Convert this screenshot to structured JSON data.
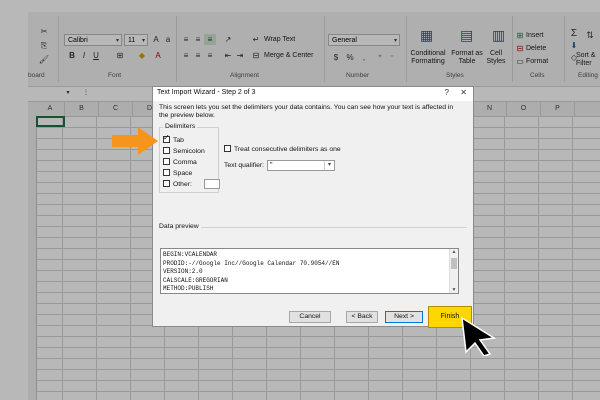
{
  "ribbon": {
    "font_name": "Calibri",
    "font_size": "11",
    "wrap_text": "Wrap Text",
    "merge_center": "Merge & Center",
    "number_format": "General",
    "conditional_formatting": "Conditional Formatting",
    "format_as_table": "Format as Table",
    "cell_styles": "Cell Styles",
    "insert": "Insert",
    "delete": "Delete",
    "format": "Format",
    "sort_filter": "Sort & Filter",
    "groups": {
      "clipboard": "board",
      "font": "Font",
      "alignment": "Alignment",
      "number": "Number",
      "styles": "Styles",
      "cells": "Cells",
      "editing": "Editing"
    }
  },
  "columns": [
    "A",
    "B",
    "C",
    "D",
    "E",
    "F",
    "G",
    "H",
    "I",
    "J",
    "K",
    "L",
    "M",
    "N",
    "O",
    "P"
  ],
  "dialog": {
    "title": "Text Import Wizard - Step 2 of 3",
    "help": "?",
    "close": "✕",
    "description": "This screen lets you set the delimiters your data contains. You can see how your text is affected in the preview below.",
    "delimiters_legend": "Delimiters",
    "delimiters": [
      {
        "label": "Tab",
        "checked": true
      },
      {
        "label": "Semicolon",
        "checked": false
      },
      {
        "label": "Comma",
        "checked": false
      },
      {
        "label": "Space",
        "checked": false
      },
      {
        "label": "Other:",
        "checked": false
      }
    ],
    "treat_consecutive": "Treat consecutive delimiters as one",
    "text_qualifier_label": "Text qualifier:",
    "text_qualifier_value": "\"",
    "data_preview_label": "Data preview",
    "preview_lines": [
      "BEGIN:VCALENDAR",
      "PRODID:-//Google Inc//Google Calendar 70.9054//EN",
      "VERSION:2.0",
      "CALSCALE:GREGORIAN",
      "METHOD:PUBLISH"
    ],
    "buttons": {
      "cancel": "Cancel",
      "back": "< Back",
      "next": "Next >",
      "finish": "Finish"
    }
  },
  "colors": {
    "highlight": "#ffd600",
    "orange_arrow": "#f7941d",
    "excel_green": "#217346"
  }
}
